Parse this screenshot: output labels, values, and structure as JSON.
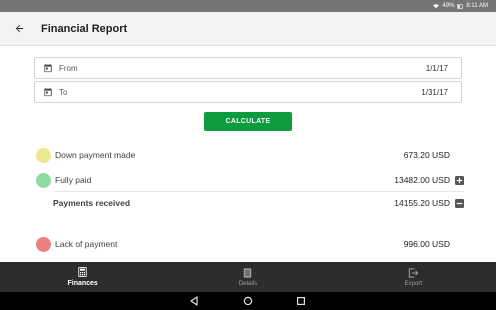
{
  "status_bar": {
    "battery": "49%",
    "time": "8:11 AM",
    "icons": [
      "wifi-icon",
      "battery-icon"
    ]
  },
  "header": {
    "title": "Financial Report",
    "back_icon": "arrow-back-icon"
  },
  "date_range": {
    "from_label": "From",
    "from_value": "1/1/17",
    "to_label": "To",
    "to_value": "1/31/17",
    "icon": "calendar-icon"
  },
  "calculate_label": "CALCULATE",
  "rows": {
    "down_payment": {
      "label": "Down payment made",
      "amount": "673.20 USD",
      "color": "#ece88f"
    },
    "fully_paid": {
      "label": "Fully paid",
      "amount": "13482.00 USD",
      "color": "#8fdaa0",
      "action_icon": "plus-box-icon"
    },
    "payments_received": {
      "label": "Payments received",
      "amount": "14155.20 USD",
      "action_icon": "minus-box-icon"
    },
    "lack_of_payment": {
      "label": "Lack of payment",
      "amount": "996.00 USD",
      "color": "#ec7f7f"
    }
  },
  "bottom_nav": {
    "items": [
      {
        "label": "Finances",
        "icon": "calculator-icon",
        "active": true
      },
      {
        "label": "Details",
        "icon": "list-icon",
        "active": false
      },
      {
        "label": "Export",
        "icon": "export-icon",
        "active": false
      }
    ]
  },
  "system_nav": [
    "back-triangle-icon",
    "home-circle-icon",
    "recents-square-icon"
  ],
  "colors": {
    "accent": "#0c9b3d",
    "status_bar": "#757575",
    "bottom_nav": "#2d2d2d"
  }
}
